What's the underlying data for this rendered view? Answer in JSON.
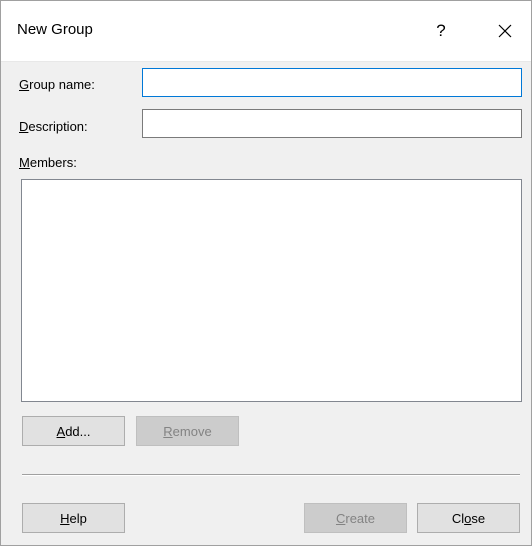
{
  "window": {
    "title": "New Group",
    "help_glyph": "?",
    "close_icon": "close-icon"
  },
  "form": {
    "group_name_label_mn": "G",
    "group_name_label_rest": "roup name:",
    "group_name_value": "",
    "description_label_mn": "D",
    "description_label_rest": "escription:",
    "description_value": "",
    "members_label_mn": "M",
    "members_label_rest": "embers:",
    "members": []
  },
  "buttons": {
    "add_mn": "A",
    "add_rest": "dd...",
    "remove_mn": "R",
    "remove_rest": "emove",
    "help_mn": "H",
    "help_rest": "elp",
    "create_mn": "C",
    "create_rest": "reate",
    "close_pre": "Cl",
    "close_mn": "o",
    "close_rest": "se"
  },
  "colors": {
    "focus_border": "#0078d7",
    "client_background": "#f0f0f0",
    "disabled_text": "#838383"
  }
}
